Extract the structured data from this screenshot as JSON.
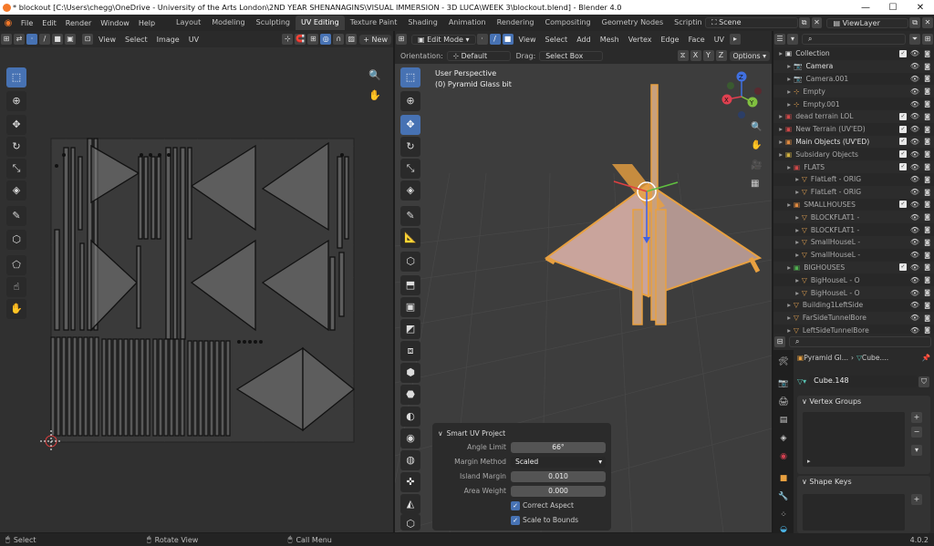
{
  "window": {
    "title": "* blockout [C:\\Users\\chegg\\OneDrive - University of the Arts London\\2ND YEAR SHENANAGINS\\VISUAL IMMERSION - 3D LUCA\\WEEK 3\\blockout.blend] - Blender 4.0",
    "minimize": "—",
    "maximize": "☐",
    "close": "✕"
  },
  "menus": [
    "File",
    "Edit",
    "Render",
    "Window",
    "Help"
  ],
  "workspaces": [
    "Layout",
    "Modeling",
    "Sculpting",
    "UV Editing",
    "Texture Paint",
    "Shading",
    "Animation",
    "Rendering",
    "Compositing",
    "Geometry Nodes",
    "Scriptin"
  ],
  "active_workspace": "UV Editing",
  "scene": "Scene",
  "view_layer": "ViewLayer",
  "uv_header": {
    "menus": [
      "View",
      "Select",
      "Image",
      "UV"
    ],
    "new_button": "+ New"
  },
  "v3d_header": {
    "mode": "Edit Mode",
    "menus": [
      "View",
      "Select",
      "Add",
      "Mesh",
      "Vertex",
      "Edge",
      "Face",
      "UV"
    ]
  },
  "v3d_subheader": {
    "orientation_label": "Orientation:",
    "orientation": "Default",
    "drag_label": "Drag:",
    "drag": "Select Box",
    "axes": [
      "X",
      "Y",
      "Z"
    ],
    "options": "Options"
  },
  "viewport": {
    "perspective": "User Perspective",
    "object": "(0) Pyramid Glass bit"
  },
  "gizmo": {
    "x": "X",
    "y": "Y",
    "z": "Z"
  },
  "operator_panel": {
    "title": "Smart UV Project",
    "fields": [
      {
        "label": "Angle Limit",
        "value": "66°"
      },
      {
        "label": "Margin Method",
        "value": "Scaled"
      },
      {
        "label": "Island Margin",
        "value": "0.010"
      },
      {
        "label": "Area Weight",
        "value": "0.000"
      }
    ],
    "checks": [
      "Correct Aspect",
      "Scale to Bounds"
    ]
  },
  "outliner": {
    "search_placeholder": "",
    "items": [
      {
        "name": "Collection",
        "depth": 0,
        "color": "#cccccc",
        "icon": "collection"
      },
      {
        "name": "Camera",
        "depth": 1,
        "color": "#e0e0e0",
        "icon": "camera"
      },
      {
        "name": "Camera.001",
        "depth": 1,
        "color": "#aaaaaa",
        "icon": "camera"
      },
      {
        "name": "Empty",
        "depth": 1,
        "color": "#aaaaaa",
        "icon": "empty"
      },
      {
        "name": "Empty.001",
        "depth": 1,
        "color": "#aaaaaa",
        "icon": "empty"
      },
      {
        "name": "dead terrain LOL",
        "depth": 0,
        "color": "#aaaaaa",
        "icon": "collection-red"
      },
      {
        "name": "New Terrain (UV'ED)",
        "depth": 0,
        "color": "#aaaaaa",
        "icon": "collection-red"
      },
      {
        "name": "Main Objects (UV'ED)",
        "depth": 0,
        "color": "#e0e0e0",
        "icon": "collection-orange"
      },
      {
        "name": "Subsidary Objects",
        "depth": 0,
        "color": "#aaaaaa",
        "icon": "collection-yellow"
      },
      {
        "name": "FLATS",
        "depth": 1,
        "color": "#aaaaaa",
        "icon": "collection-red"
      },
      {
        "name": "FlatLeft - ORIG",
        "depth": 2,
        "color": "#aaaaaa",
        "icon": "mesh"
      },
      {
        "name": "FlatLeft - ORIG",
        "depth": 2,
        "color": "#aaaaaa",
        "icon": "mesh"
      },
      {
        "name": "SMALLHOUSES",
        "depth": 1,
        "color": "#aaaaaa",
        "icon": "collection-orange"
      },
      {
        "name": "BLOCKFLAT1 -",
        "depth": 2,
        "color": "#aaaaaa",
        "icon": "mesh"
      },
      {
        "name": "BLOCKFLAT1 -",
        "depth": 2,
        "color": "#aaaaaa",
        "icon": "mesh"
      },
      {
        "name": "SmallHouseL -",
        "depth": 2,
        "color": "#aaaaaa",
        "icon": "mesh"
      },
      {
        "name": "SmallHouseL -",
        "depth": 2,
        "color": "#aaaaaa",
        "icon": "mesh"
      },
      {
        "name": "BIGHOUSES",
        "depth": 1,
        "color": "#aaaaaa",
        "icon": "collection-green"
      },
      {
        "name": "BigHouseL - O",
        "depth": 2,
        "color": "#aaaaaa",
        "icon": "mesh"
      },
      {
        "name": "BigHouseL - O",
        "depth": 2,
        "color": "#aaaaaa",
        "icon": "mesh"
      },
      {
        "name": "Building1LeftSide",
        "depth": 1,
        "color": "#aaaaaa",
        "icon": "mesh"
      },
      {
        "name": "FarSideTunnelBore",
        "depth": 1,
        "color": "#aaaaaa",
        "icon": "mesh"
      },
      {
        "name": "LeftSideTunnelBore",
        "depth": 1,
        "color": "#aaaaaa",
        "icon": "mesh"
      }
    ]
  },
  "properties": {
    "breadcrumb_object": "Pyramid Gl...",
    "breadcrumb_data": "Cube....",
    "mesh_name": "Cube.148",
    "vertex_groups": "Vertex Groups",
    "shape_keys": "Shape Keys",
    "add": "+",
    "remove": "−",
    "expand": "▸"
  },
  "statusbar": {
    "select": "Select",
    "rotate": "Rotate View",
    "menu": "Call Menu",
    "version": "4.0.2"
  }
}
